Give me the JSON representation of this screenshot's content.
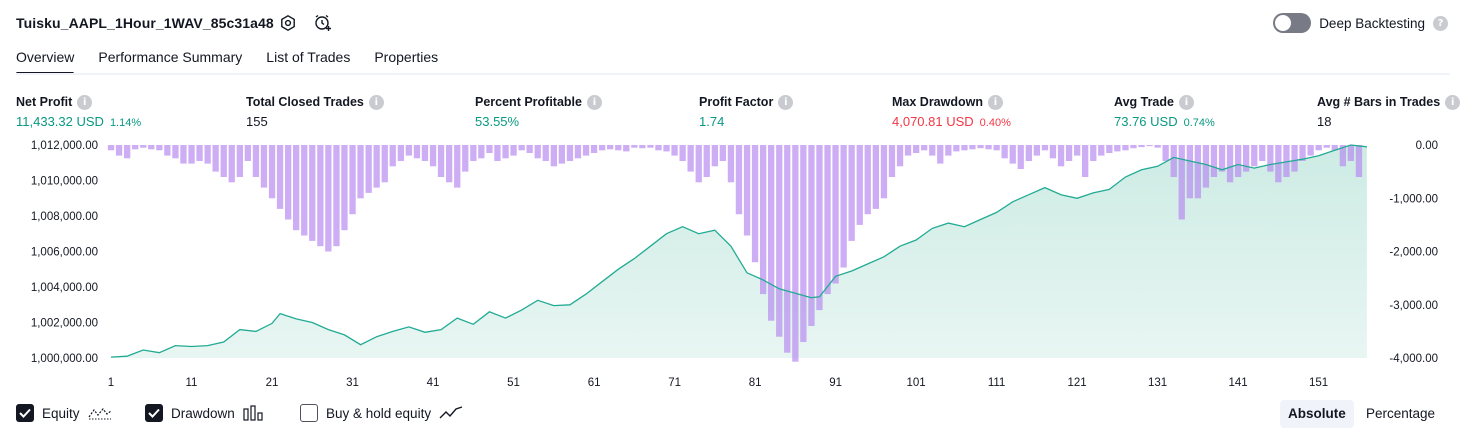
{
  "header": {
    "strategy_name": "Tuisku_AAPL_1Hour_1WAV_85c31a48",
    "deep_backtesting_label": "Deep Backtesting",
    "deep_backtesting_enabled": false
  },
  "tabs": [
    {
      "label": "Overview",
      "active": true
    },
    {
      "label": "Performance Summary",
      "active": false
    },
    {
      "label": "List of Trades",
      "active": false
    },
    {
      "label": "Properties",
      "active": false
    }
  ],
  "metrics": [
    {
      "label": "Net Profit",
      "value": "11,433.32 USD",
      "pct": "1.14%",
      "color": "#089981"
    },
    {
      "label": "Total Closed Trades",
      "value": "155",
      "pct": "",
      "color": "#131722"
    },
    {
      "label": "Percent Profitable",
      "value": "53.55%",
      "pct": "",
      "color": "#089981"
    },
    {
      "label": "Profit Factor",
      "value": "1.74",
      "pct": "",
      "color": "#089981"
    },
    {
      "label": "Max Drawdown",
      "value": "4,070.81 USD",
      "pct": "0.40%",
      "color": "#f23645"
    },
    {
      "label": "Avg Trade",
      "value": "73.76 USD",
      "pct": "0.74%",
      "color": "#089981"
    },
    {
      "label": "Avg # Bars in Trades",
      "value": "18",
      "pct": "",
      "color": "#131722"
    }
  ],
  "legend": {
    "equity_label": "Equity",
    "equity_checked": true,
    "drawdown_label": "Drawdown",
    "drawdown_checked": true,
    "buyhold_label": "Buy & hold equity",
    "buyhold_checked": false
  },
  "modes": {
    "absolute_label": "Absolute",
    "percentage_label": "Percentage",
    "selected": "absolute"
  },
  "colors": {
    "equity_line": "#22ab94",
    "equity_fill": "#cdebe4",
    "drawdown_bar": "#b88cf0",
    "positive": "#089981",
    "negative": "#f23645",
    "text": "#131722"
  },
  "chart_data": {
    "type": "area",
    "left_axis": {
      "label": "Equity",
      "ticks": [
        "1,012,000.00",
        "1,010,000.00",
        "1,008,000.00",
        "1,006,000.00",
        "1,004,000.00",
        "1,002,000.00",
        "1,000,000.00"
      ],
      "range": [
        1000000,
        1012000
      ]
    },
    "right_axis": {
      "label": "Drawdown",
      "ticks": [
        "0.00",
        "-1,000.00",
        "-2,000.00",
        "-3,000.00",
        "-4,000.00"
      ],
      "range": [
        -4000,
        0
      ]
    },
    "x_ticks": [
      "1",
      "11",
      "21",
      "31",
      "41",
      "51",
      "61",
      "71",
      "81",
      "91",
      "101",
      "111",
      "121",
      "131",
      "141",
      "151"
    ],
    "x_range": [
      1,
      158
    ],
    "series": [
      {
        "name": "Equity",
        "type": "area",
        "points": [
          [
            1,
            1000050
          ],
          [
            3,
            1000100
          ],
          [
            5,
            1000450
          ],
          [
            7,
            1000300
          ],
          [
            9,
            1000700
          ],
          [
            11,
            1000650
          ],
          [
            13,
            1000700
          ],
          [
            15,
            1000900
          ],
          [
            17,
            1001600
          ],
          [
            19,
            1001500
          ],
          [
            21,
            1001950
          ],
          [
            22,
            1002500
          ],
          [
            24,
            1002200
          ],
          [
            26,
            1002000
          ],
          [
            28,
            1001600
          ],
          [
            30,
            1001300
          ],
          [
            32,
            1000750
          ],
          [
            34,
            1001200
          ],
          [
            36,
            1001500
          ],
          [
            38,
            1001750
          ],
          [
            40,
            1001450
          ],
          [
            42,
            1001600
          ],
          [
            44,
            1002250
          ],
          [
            46,
            1001900
          ],
          [
            48,
            1002600
          ],
          [
            50,
            1002250
          ],
          [
            52,
            1002700
          ],
          [
            54,
            1003250
          ],
          [
            56,
            1002950
          ],
          [
            58,
            1003000
          ],
          [
            60,
            1003600
          ],
          [
            62,
            1004300
          ],
          [
            64,
            1005000
          ],
          [
            66,
            1005600
          ],
          [
            68,
            1006300
          ],
          [
            70,
            1007000
          ],
          [
            72,
            1007400
          ],
          [
            74,
            1007000
          ],
          [
            76,
            1007200
          ],
          [
            78,
            1006300
          ],
          [
            80,
            1004800
          ],
          [
            82,
            1004400
          ],
          [
            84,
            1003900
          ],
          [
            86,
            1003650
          ],
          [
            88,
            1003400
          ],
          [
            89,
            1003450
          ],
          [
            91,
            1004600
          ],
          [
            93,
            1004900
          ],
          [
            95,
            1005300
          ],
          [
            97,
            1005700
          ],
          [
            99,
            1006300
          ],
          [
            101,
            1006650
          ],
          [
            103,
            1007300
          ],
          [
            105,
            1007600
          ],
          [
            107,
            1007400
          ],
          [
            109,
            1007800
          ],
          [
            111,
            1008200
          ],
          [
            113,
            1008800
          ],
          [
            115,
            1009200
          ],
          [
            117,
            1009600
          ],
          [
            119,
            1009200
          ],
          [
            121,
            1009000
          ],
          [
            123,
            1009300
          ],
          [
            125,
            1009500
          ],
          [
            127,
            1010200
          ],
          [
            129,
            1010600
          ],
          [
            131,
            1010800
          ],
          [
            133,
            1011300
          ],
          [
            135,
            1011100
          ],
          [
            137,
            1010900
          ],
          [
            139,
            1010600
          ],
          [
            141,
            1010900
          ],
          [
            143,
            1010700
          ],
          [
            145,
            1010900
          ],
          [
            147,
            1011050
          ],
          [
            149,
            1011200
          ],
          [
            151,
            1011400
          ],
          [
            153,
            1011700
          ],
          [
            155,
            1012000
          ],
          [
            157,
            1011900
          ]
        ]
      },
      {
        "name": "Drawdown",
        "type": "bar",
        "values": [
          -100,
          -200,
          -250,
          -80,
          -50,
          -80,
          -100,
          -200,
          -250,
          -350,
          -350,
          -300,
          -350,
          -500,
          -600,
          -700,
          -600,
          -300,
          -600,
          -800,
          -1000,
          -1200,
          -1400,
          -1600,
          -1700,
          -1800,
          -1900,
          -2000,
          -1900,
          -1600,
          -1300,
          -1000,
          -900,
          -800,
          -700,
          -400,
          -300,
          -200,
          -250,
          -300,
          -400,
          -600,
          -700,
          -800,
          -500,
          -300,
          -250,
          -150,
          -300,
          -250,
          -200,
          -100,
          -150,
          -250,
          -300,
          -400,
          -350,
          -300,
          -250,
          -200,
          -150,
          -100,
          -80,
          -100,
          -120,
          -50,
          -60,
          -50,
          -100,
          -120,
          -200,
          -300,
          -500,
          -700,
          -600,
          -400,
          -300,
          -700,
          -1300,
          -1700,
          -2200,
          -2800,
          -3300,
          -3600,
          -3900,
          -4070,
          -3700,
          -3400,
          -3100,
          -2800,
          -2600,
          -2300,
          -1800,
          -1500,
          -1300,
          -1200,
          -1000,
          -600,
          -400,
          -200,
          -150,
          -100,
          -200,
          -350,
          -200,
          -120,
          -100,
          -80,
          -60,
          -80,
          -100,
          -250,
          -350,
          -450,
          -300,
          -200,
          -100,
          -250,
          -400,
          -300,
          -200,
          -600,
          -300,
          -200,
          -150,
          -120,
          -100,
          -60,
          -40,
          -20,
          -50,
          -300,
          -600,
          -1400,
          -1000,
          -1000,
          -800,
          -600,
          -500,
          -700,
          -600,
          -500,
          -400,
          -300,
          -500,
          -700,
          -600,
          -500,
          -300,
          -200,
          -100,
          -50,
          -100,
          -400,
          -300,
          -600
        ]
      }
    ]
  }
}
